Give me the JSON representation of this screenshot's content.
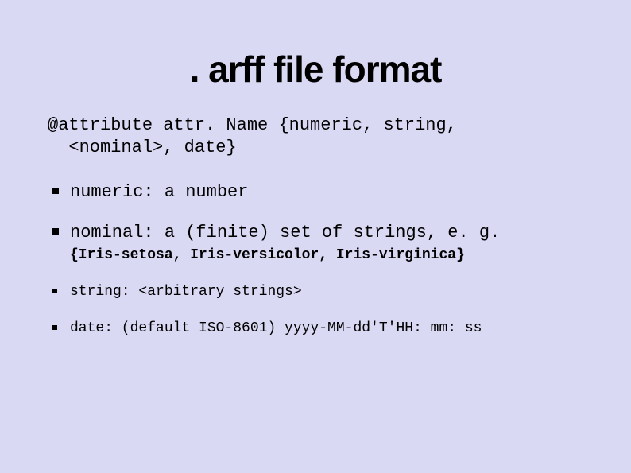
{
  "title": ". arff file format",
  "intro_line1": "@attribute attr. Name {numeric, string,",
  "intro_line2": "<nominal>, date}",
  "bullets": [
    {
      "main": "numeric: a number"
    },
    {
      "main": "nominal: a (finite) set of strings, e. g.",
      "sub": "{Iris-setosa, Iris-versicolor, Iris-virginica}"
    },
    {
      "small": "string: <arbitrary strings>"
    },
    {
      "small": "date: (default ISO-8601) yyyy-MM-dd'T'HH: mm: ss"
    }
  ]
}
